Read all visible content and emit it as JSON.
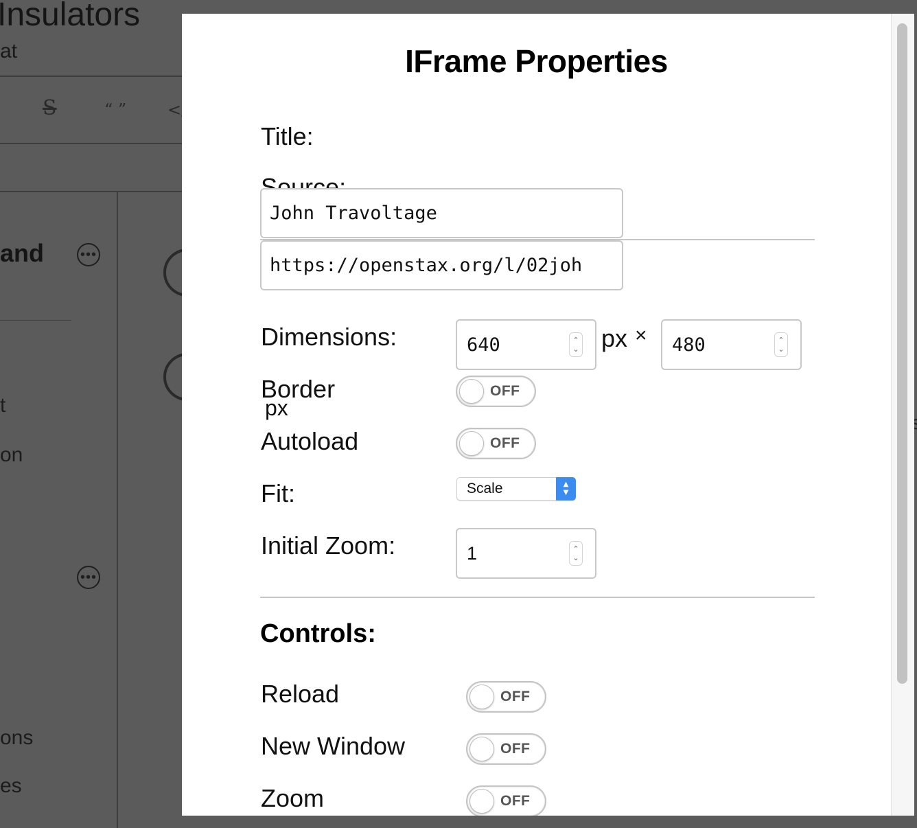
{
  "background": {
    "title": "Insulators",
    "subtitle": "at",
    "toolbar_items": [
      "S",
      "“ ”",
      "</"
    ],
    "section_heading": "and",
    "list_items": [
      "t",
      "on",
      "ons",
      "es"
    ],
    "edge_text": "s"
  },
  "modal": {
    "title": "IFrame Properties",
    "fields": {
      "title_label": "Title:",
      "title_value": "John Travoltage",
      "source_label": "Source:",
      "source_value": "https://openstax.org/l/02joh",
      "dimensions_label": "Dimensions:",
      "width_value": "640",
      "width_unit": "px",
      "times": "×",
      "height_value": "480",
      "border_label": "Border",
      "border_unit": "px",
      "border_toggle": "OFF",
      "autoload_label": "Autoload",
      "autoload_toggle": "OFF",
      "fit_label": "Fit:",
      "fit_value": "Scale",
      "zoom_label": "Initial Zoom:",
      "zoom_value": "1"
    },
    "controls": {
      "heading": "Controls:",
      "reload_label": "Reload",
      "reload_toggle": "OFF",
      "new_window_label": "New Window",
      "new_window_toggle": "OFF",
      "zoom_label": "Zoom",
      "zoom_toggle": "OFF"
    }
  },
  "colors": {
    "overlay": "#5b5b5b",
    "select_accent": "#3b8cf0"
  }
}
